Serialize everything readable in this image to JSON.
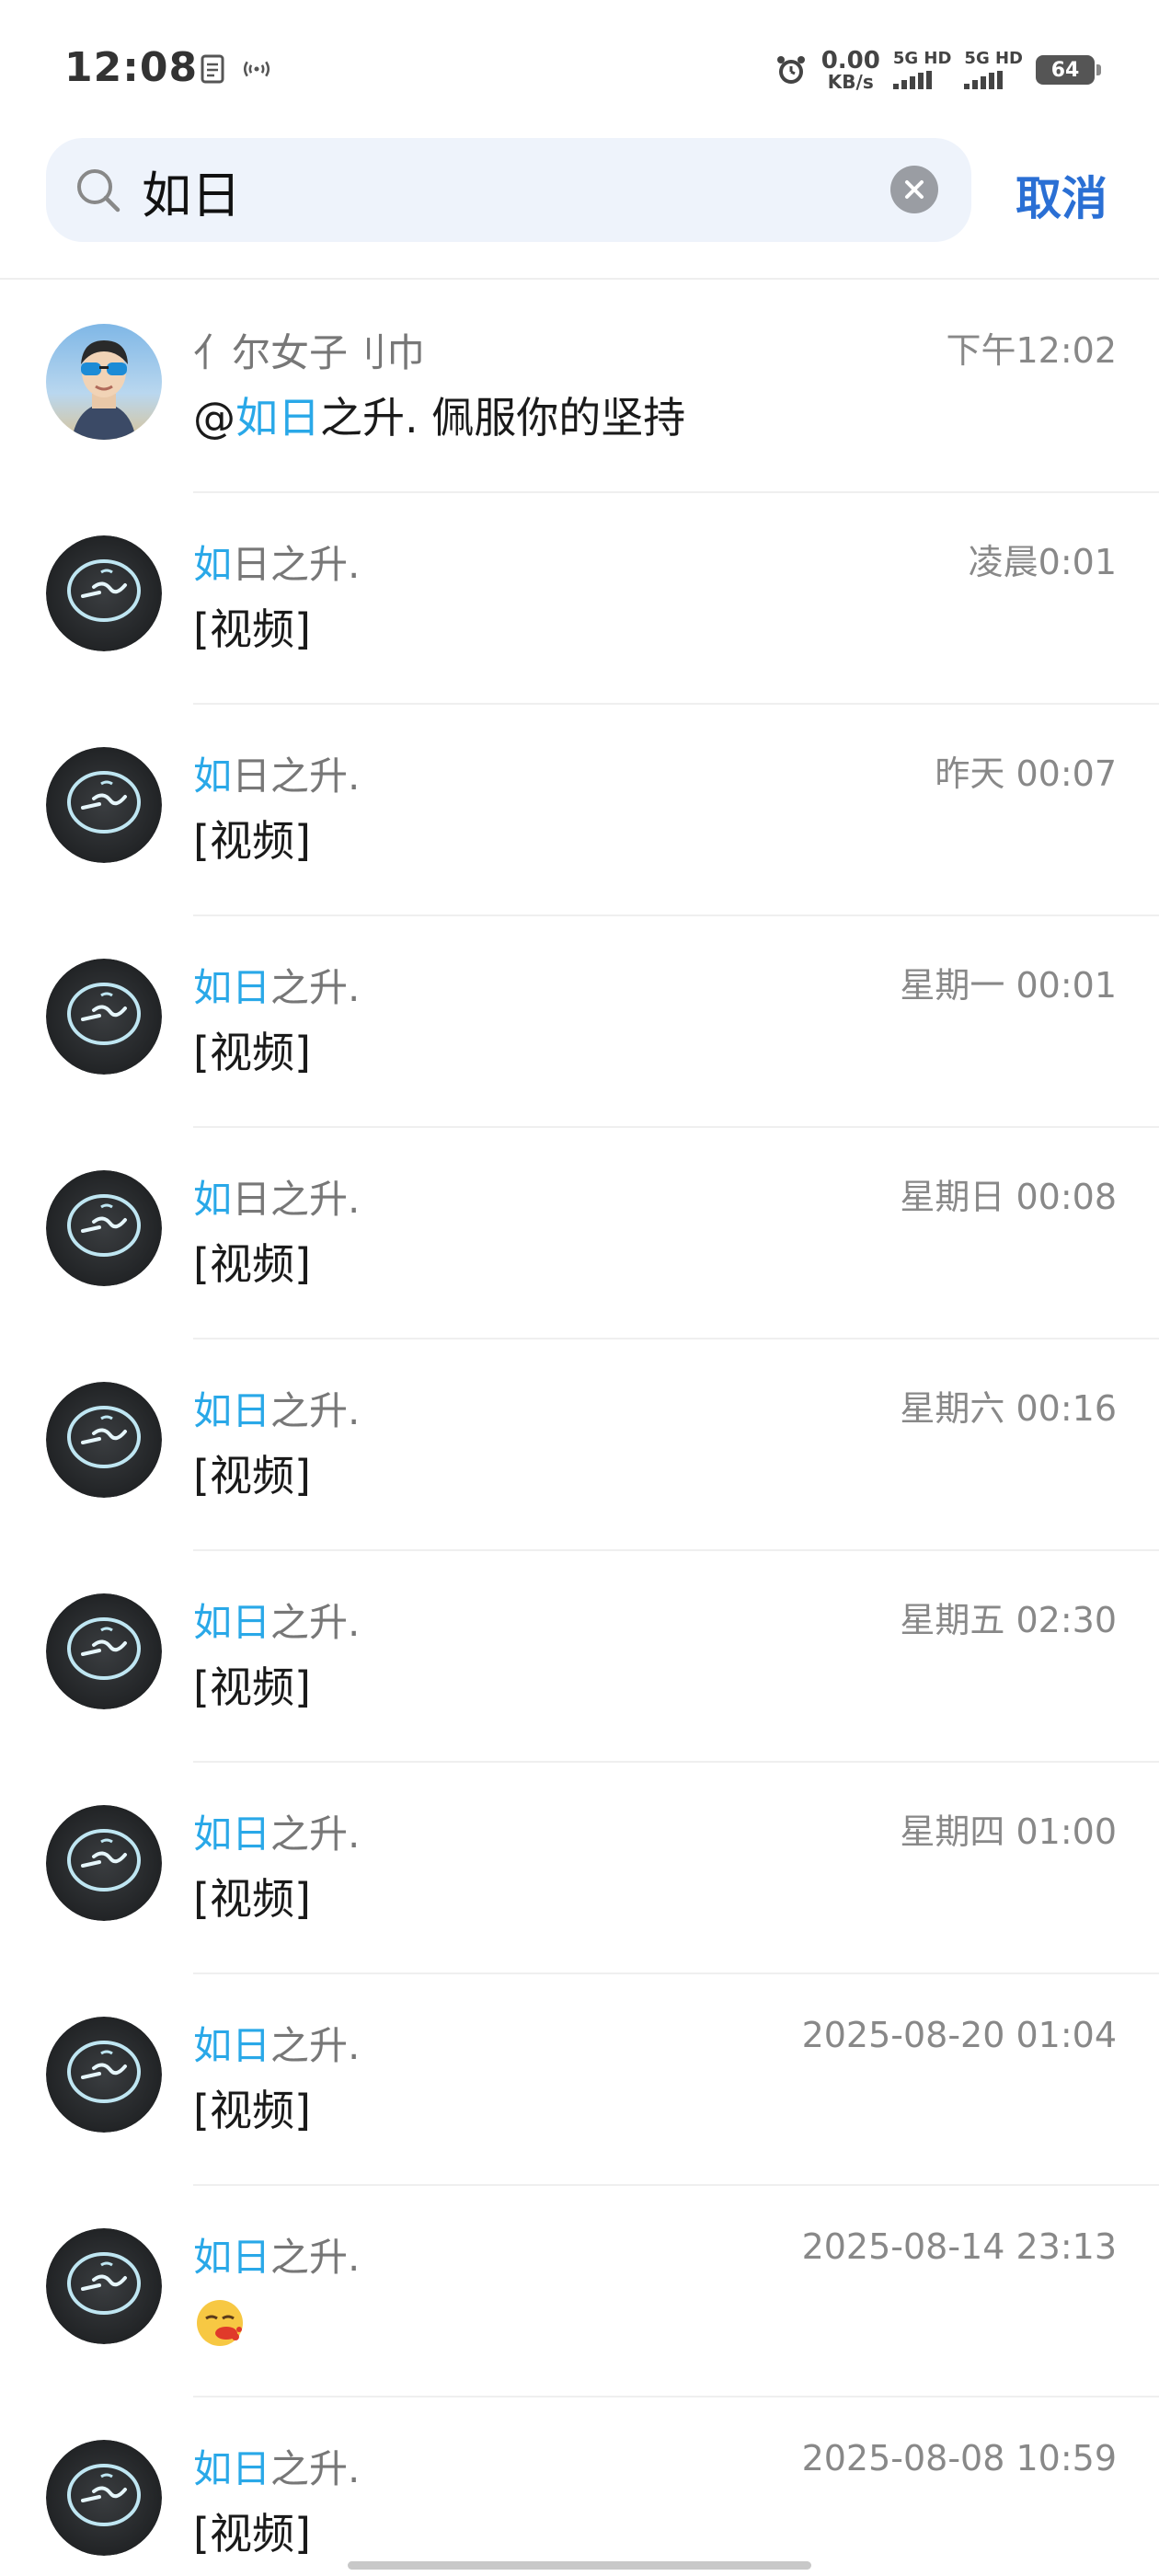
{
  "status_bar": {
    "time": "12:08",
    "net_speed_value": "0.00",
    "net_speed_unit": "KB/s",
    "sim1_label": "5G HD",
    "sim2_label": "5G HD",
    "battery_level": "64"
  },
  "search": {
    "query": "如日",
    "cancel_label": "取消"
  },
  "colors": {
    "highlight": "#29a8e8",
    "cancel": "#2a6fd4",
    "search_bg": "#eef3fb"
  },
  "results": [
    {
      "name_parts": [
        "亻尔女子刂巾",
        "",
        ""
      ],
      "name_plain": "亻尔女子刂巾",
      "time": "下午12:02",
      "msg_prefix": "@",
      "msg_highlight": "如日",
      "msg_rest": "之升. 佩服你的坚持",
      "avatar": "person-sunglasses"
    },
    {
      "name_highlight": "如",
      "name_rest": "日之升.",
      "time": "凌晨0:01",
      "msg": "[视频]",
      "avatar": "logo-circle"
    },
    {
      "name_highlight": "如",
      "name_rest": "日之升.",
      "time": "昨天 00:07",
      "msg": "[视频]",
      "avatar": "logo-circle"
    },
    {
      "name_highlight": "如日",
      "name_rest": "之升.",
      "time": "星期一 00:01",
      "msg": "[视频]",
      "avatar": "logo-circle"
    },
    {
      "name_highlight": "如",
      "name_rest": "日之升.",
      "time": "星期日 00:08",
      "msg": "[视频]",
      "avatar": "logo-circle"
    },
    {
      "name_highlight": "如日",
      "name_rest": "之升.",
      "time": "星期六 00:16",
      "msg": "[视频]",
      "avatar": "logo-circle"
    },
    {
      "name_highlight": "如日",
      "name_rest": "之升.",
      "time": "星期五 02:30",
      "msg": "[视频]",
      "avatar": "logo-circle"
    },
    {
      "name_highlight": "如日",
      "name_rest": "之升.",
      "time": "星期四 01:00",
      "msg": "[视频]",
      "avatar": "logo-circle"
    },
    {
      "name_highlight": "如日",
      "name_rest": "之升.",
      "time": "2025-08-20 01:04",
      "msg": "[视频]",
      "avatar": "logo-circle"
    },
    {
      "name_highlight": "如日",
      "name_rest": "之升.",
      "time": "2025-08-14 23:13",
      "msg": "",
      "emoji": "sick-emoji",
      "avatar": "logo-circle"
    },
    {
      "name_highlight": "如日",
      "name_rest": "之升.",
      "time": "2025-08-08 10:59",
      "msg": "[视频]",
      "avatar": "logo-circle"
    }
  ]
}
